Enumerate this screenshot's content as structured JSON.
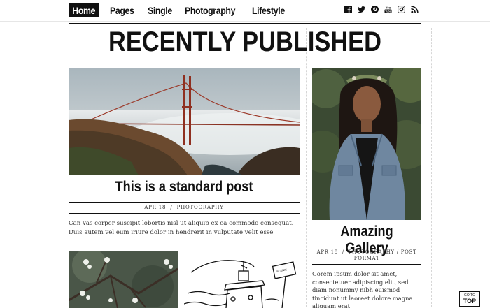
{
  "nav": {
    "items": [
      {
        "label": "Home",
        "active": true
      },
      {
        "label": "Pages",
        "active": false
      },
      {
        "label": "Single",
        "active": false
      },
      {
        "label": "Photography",
        "active": false
      },
      {
        "label": "Lifestyle",
        "active": false
      }
    ]
  },
  "social": [
    "facebook-icon",
    "twitter-icon",
    "pinterest-icon",
    "youtube-icon",
    "instagram-icon",
    "rss-icon"
  ],
  "section_title": "RECENTLY PUBLISHED",
  "posts": [
    {
      "title": "This is a standard post",
      "date": "APR 18",
      "category": "PHOTOGRAPHY",
      "excerpt": "Can vas corper suscipit lobortis nisl ut aliquip ex ea commodo consequat. Duis autem vel eum iriure dolor in hendrerit in vulputate velit esse",
      "image": "golden-gate-bridge-photo"
    },
    {
      "title": "Amazing Gallery",
      "date": "APR 18",
      "category": "PHOTOGRAPHY",
      "format": "POST FORMAT",
      "excerpt": "Gorem ipsum dolor sit amet, consectetuer adipiscing elit, sed diam nonummy nibh euismod tincidunt ut laoreet dolore magna aliquam erat",
      "image": "portrait-woman-photo"
    }
  ],
  "thumbs": [
    "blossom-branch-photo",
    "boat-sketch-illustration"
  ],
  "sep": "/",
  "gotop": {
    "line1": "GO TO",
    "line2": "TOP"
  }
}
